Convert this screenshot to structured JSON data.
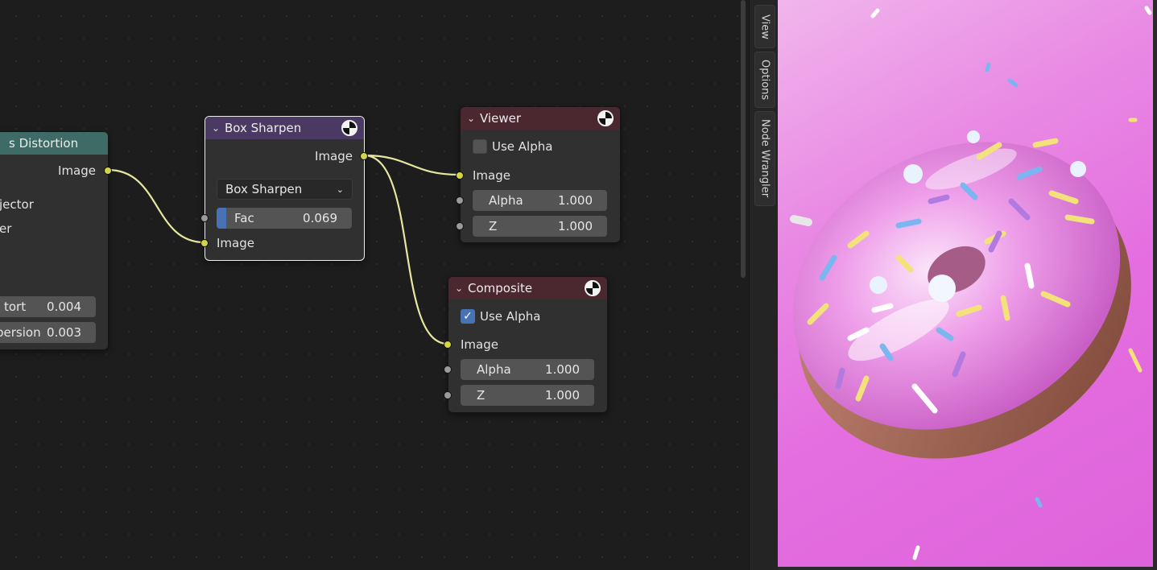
{
  "sidebar_tabs": [
    "View",
    "Options",
    "Node Wrangler"
  ],
  "lens_node": {
    "title": "s Distortion",
    "output_image": "Image",
    "partial_labels": [
      "jector",
      "er"
    ],
    "fields": [
      {
        "label": "tort",
        "value": "0.004"
      },
      {
        "label": "persion",
        "value": "0.003"
      }
    ]
  },
  "box_sharpen_node": {
    "title": "Box Sharpen",
    "output_image": "Image",
    "mode": "Box Sharpen",
    "fac_label": "Fac",
    "fac_value": "0.069",
    "fac_fraction": 0.069,
    "input_image": "Image"
  },
  "viewer_node": {
    "title": "Viewer",
    "use_alpha_label": "Use Alpha",
    "use_alpha": false,
    "input_image": "Image",
    "alpha_label": "Alpha",
    "alpha_value": "1.000",
    "z_label": "Z",
    "z_value": "1.000"
  },
  "composite_node": {
    "title": "Composite",
    "use_alpha_label": "Use Alpha",
    "use_alpha": true,
    "input_image": "Image",
    "alpha_label": "Alpha",
    "alpha_value": "1.000",
    "z_label": "Z",
    "z_value": "1.000"
  },
  "colors": {
    "wire": "#e7e7a0",
    "socket_image": "#d4d44a",
    "header_distortion": "#3e6b66",
    "header_filter": "#4a3a63",
    "header_output": "#4b2730",
    "preview_bg": "#e46ee0"
  }
}
